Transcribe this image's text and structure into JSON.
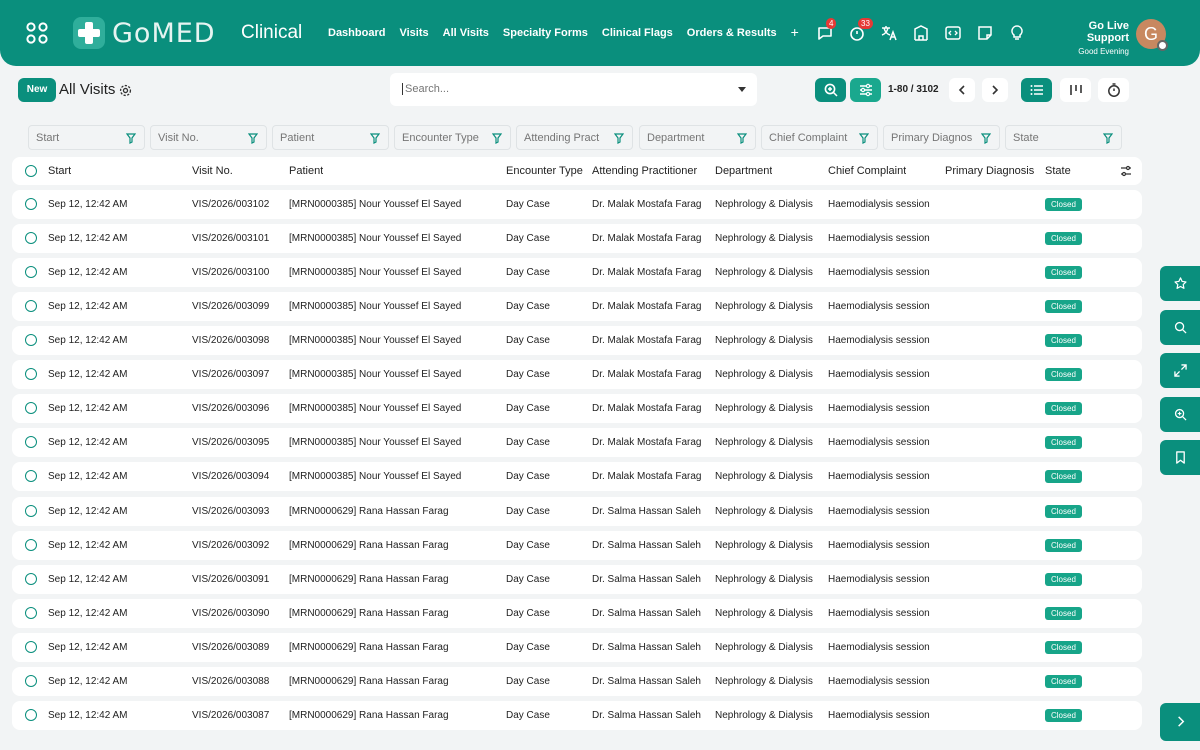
{
  "header": {
    "logo_text": "GoMED",
    "module": "Clinical",
    "nav": [
      "Dashboard",
      "Visits",
      "All Visits",
      "Specialty Forms",
      "Clinical Flags",
      "Orders & Results",
      "+"
    ],
    "badges": {
      "chat": "4",
      "timer": "33"
    },
    "support_label": "Go Live Support",
    "greeting": "Good Evening",
    "avatar_initial": "G"
  },
  "toolbar": {
    "new_label": "New",
    "title": "All Visits",
    "search_placeholder": "Search...",
    "pager": "1-80 / 3102"
  },
  "filters": [
    "Start",
    "Visit No.",
    "Patient",
    "Encounter Type",
    "Attending Pract",
    "Department",
    "Chief Complaint",
    "Primary Diagnos",
    "State"
  ],
  "columns": [
    "Start",
    "Visit No.",
    "Patient",
    "Encounter Type",
    "Attending Practitioner",
    "Department",
    "Chief Complaint",
    "Primary Diagnosis",
    "State"
  ],
  "rows": [
    {
      "start": "Sep 12, 12:42 AM",
      "visit": "VIS/2026/003102",
      "patient": "[MRN0000385] Nour Youssef El Sayed",
      "encounter": "Day Case",
      "practitioner": "Dr. Malak Mostafa Farag",
      "department": "Nephrology & Dialysis",
      "complaint": "Haemodialysis session",
      "diagnosis": "",
      "state": "Closed"
    },
    {
      "start": "Sep 12, 12:42 AM",
      "visit": "VIS/2026/003101",
      "patient": "[MRN0000385] Nour Youssef El Sayed",
      "encounter": "Day Case",
      "practitioner": "Dr. Malak Mostafa Farag",
      "department": "Nephrology & Dialysis",
      "complaint": "Haemodialysis session",
      "diagnosis": "",
      "state": "Closed"
    },
    {
      "start": "Sep 12, 12:42 AM",
      "visit": "VIS/2026/003100",
      "patient": "[MRN0000385] Nour Youssef El Sayed",
      "encounter": "Day Case",
      "practitioner": "Dr. Malak Mostafa Farag",
      "department": "Nephrology & Dialysis",
      "complaint": "Haemodialysis session",
      "diagnosis": "",
      "state": "Closed"
    },
    {
      "start": "Sep 12, 12:42 AM",
      "visit": "VIS/2026/003099",
      "patient": "[MRN0000385] Nour Youssef El Sayed",
      "encounter": "Day Case",
      "practitioner": "Dr. Malak Mostafa Farag",
      "department": "Nephrology & Dialysis",
      "complaint": "Haemodialysis session",
      "diagnosis": "",
      "state": "Closed"
    },
    {
      "start": "Sep 12, 12:42 AM",
      "visit": "VIS/2026/003098",
      "patient": "[MRN0000385] Nour Youssef El Sayed",
      "encounter": "Day Case",
      "practitioner": "Dr. Malak Mostafa Farag",
      "department": "Nephrology & Dialysis",
      "complaint": "Haemodialysis session",
      "diagnosis": "",
      "state": "Closed"
    },
    {
      "start": "Sep 12, 12:42 AM",
      "visit": "VIS/2026/003097",
      "patient": "[MRN0000385] Nour Youssef El Sayed",
      "encounter": "Day Case",
      "practitioner": "Dr. Malak Mostafa Farag",
      "department": "Nephrology & Dialysis",
      "complaint": "Haemodialysis session",
      "diagnosis": "",
      "state": "Closed"
    },
    {
      "start": "Sep 12, 12:42 AM",
      "visit": "VIS/2026/003096",
      "patient": "[MRN0000385] Nour Youssef El Sayed",
      "encounter": "Day Case",
      "practitioner": "Dr. Malak Mostafa Farag",
      "department": "Nephrology & Dialysis",
      "complaint": "Haemodialysis session",
      "diagnosis": "",
      "state": "Closed"
    },
    {
      "start": "Sep 12, 12:42 AM",
      "visit": "VIS/2026/003095",
      "patient": "[MRN0000385] Nour Youssef El Sayed",
      "encounter": "Day Case",
      "practitioner": "Dr. Malak Mostafa Farag",
      "department": "Nephrology & Dialysis",
      "complaint": "Haemodialysis session",
      "diagnosis": "",
      "state": "Closed"
    },
    {
      "start": "Sep 12, 12:42 AM",
      "visit": "VIS/2026/003094",
      "patient": "[MRN0000385] Nour Youssef El Sayed",
      "encounter": "Day Case",
      "practitioner": "Dr. Malak Mostafa Farag",
      "department": "Nephrology & Dialysis",
      "complaint": "Haemodialysis session",
      "diagnosis": "",
      "state": "Closed"
    },
    {
      "start": "Sep 12, 12:42 AM",
      "visit": "VIS/2026/003093",
      "patient": "[MRN0000629] Rana Hassan Farag",
      "encounter": "Day Case",
      "practitioner": "Dr. Salma Hassan Saleh",
      "department": "Nephrology & Dialysis",
      "complaint": "Haemodialysis session",
      "diagnosis": "",
      "state": "Closed"
    },
    {
      "start": "Sep 12, 12:42 AM",
      "visit": "VIS/2026/003092",
      "patient": "[MRN0000629] Rana Hassan Farag",
      "encounter": "Day Case",
      "practitioner": "Dr. Salma Hassan Saleh",
      "department": "Nephrology & Dialysis",
      "complaint": "Haemodialysis session",
      "diagnosis": "",
      "state": "Closed"
    },
    {
      "start": "Sep 12, 12:42 AM",
      "visit": "VIS/2026/003091",
      "patient": "[MRN0000629] Rana Hassan Farag",
      "encounter": "Day Case",
      "practitioner": "Dr. Salma Hassan Saleh",
      "department": "Nephrology & Dialysis",
      "complaint": "Haemodialysis session",
      "diagnosis": "",
      "state": "Closed"
    },
    {
      "start": "Sep 12, 12:42 AM",
      "visit": "VIS/2026/003090",
      "patient": "[MRN0000629] Rana Hassan Farag",
      "encounter": "Day Case",
      "practitioner": "Dr. Salma Hassan Saleh",
      "department": "Nephrology & Dialysis",
      "complaint": "Haemodialysis session",
      "diagnosis": "",
      "state": "Closed"
    },
    {
      "start": "Sep 12, 12:42 AM",
      "visit": "VIS/2026/003089",
      "patient": "[MRN0000629] Rana Hassan Farag",
      "encounter": "Day Case",
      "practitioner": "Dr. Salma Hassan Saleh",
      "department": "Nephrology & Dialysis",
      "complaint": "Haemodialysis session",
      "diagnosis": "",
      "state": "Closed"
    },
    {
      "start": "Sep 12, 12:42 AM",
      "visit": "VIS/2026/003088",
      "patient": "[MRN0000629] Rana Hassan Farag",
      "encounter": "Day Case",
      "practitioner": "Dr. Salma Hassan Saleh",
      "department": "Nephrology & Dialysis",
      "complaint": "Haemodialysis session",
      "diagnosis": "",
      "state": "Closed"
    },
    {
      "start": "Sep 12, 12:42 AM",
      "visit": "VIS/2026/003087",
      "patient": "[MRN0000629] Rana Hassan Farag",
      "encounter": "Day Case",
      "practitioner": "Dr. Salma Hassan Saleh",
      "department": "Nephrology & Dialysis",
      "complaint": "Haemodialysis session",
      "diagnosis": "",
      "state": "Closed"
    }
  ],
  "side_panel": [
    "star-icon",
    "search-icon",
    "expand-icon",
    "zoom-icon",
    "bookmark-icon",
    "chevron-right-icon"
  ],
  "colors": {
    "primary": "#0a8f7d",
    "status_closed": "#17a589",
    "background": "#f2f4f5"
  }
}
